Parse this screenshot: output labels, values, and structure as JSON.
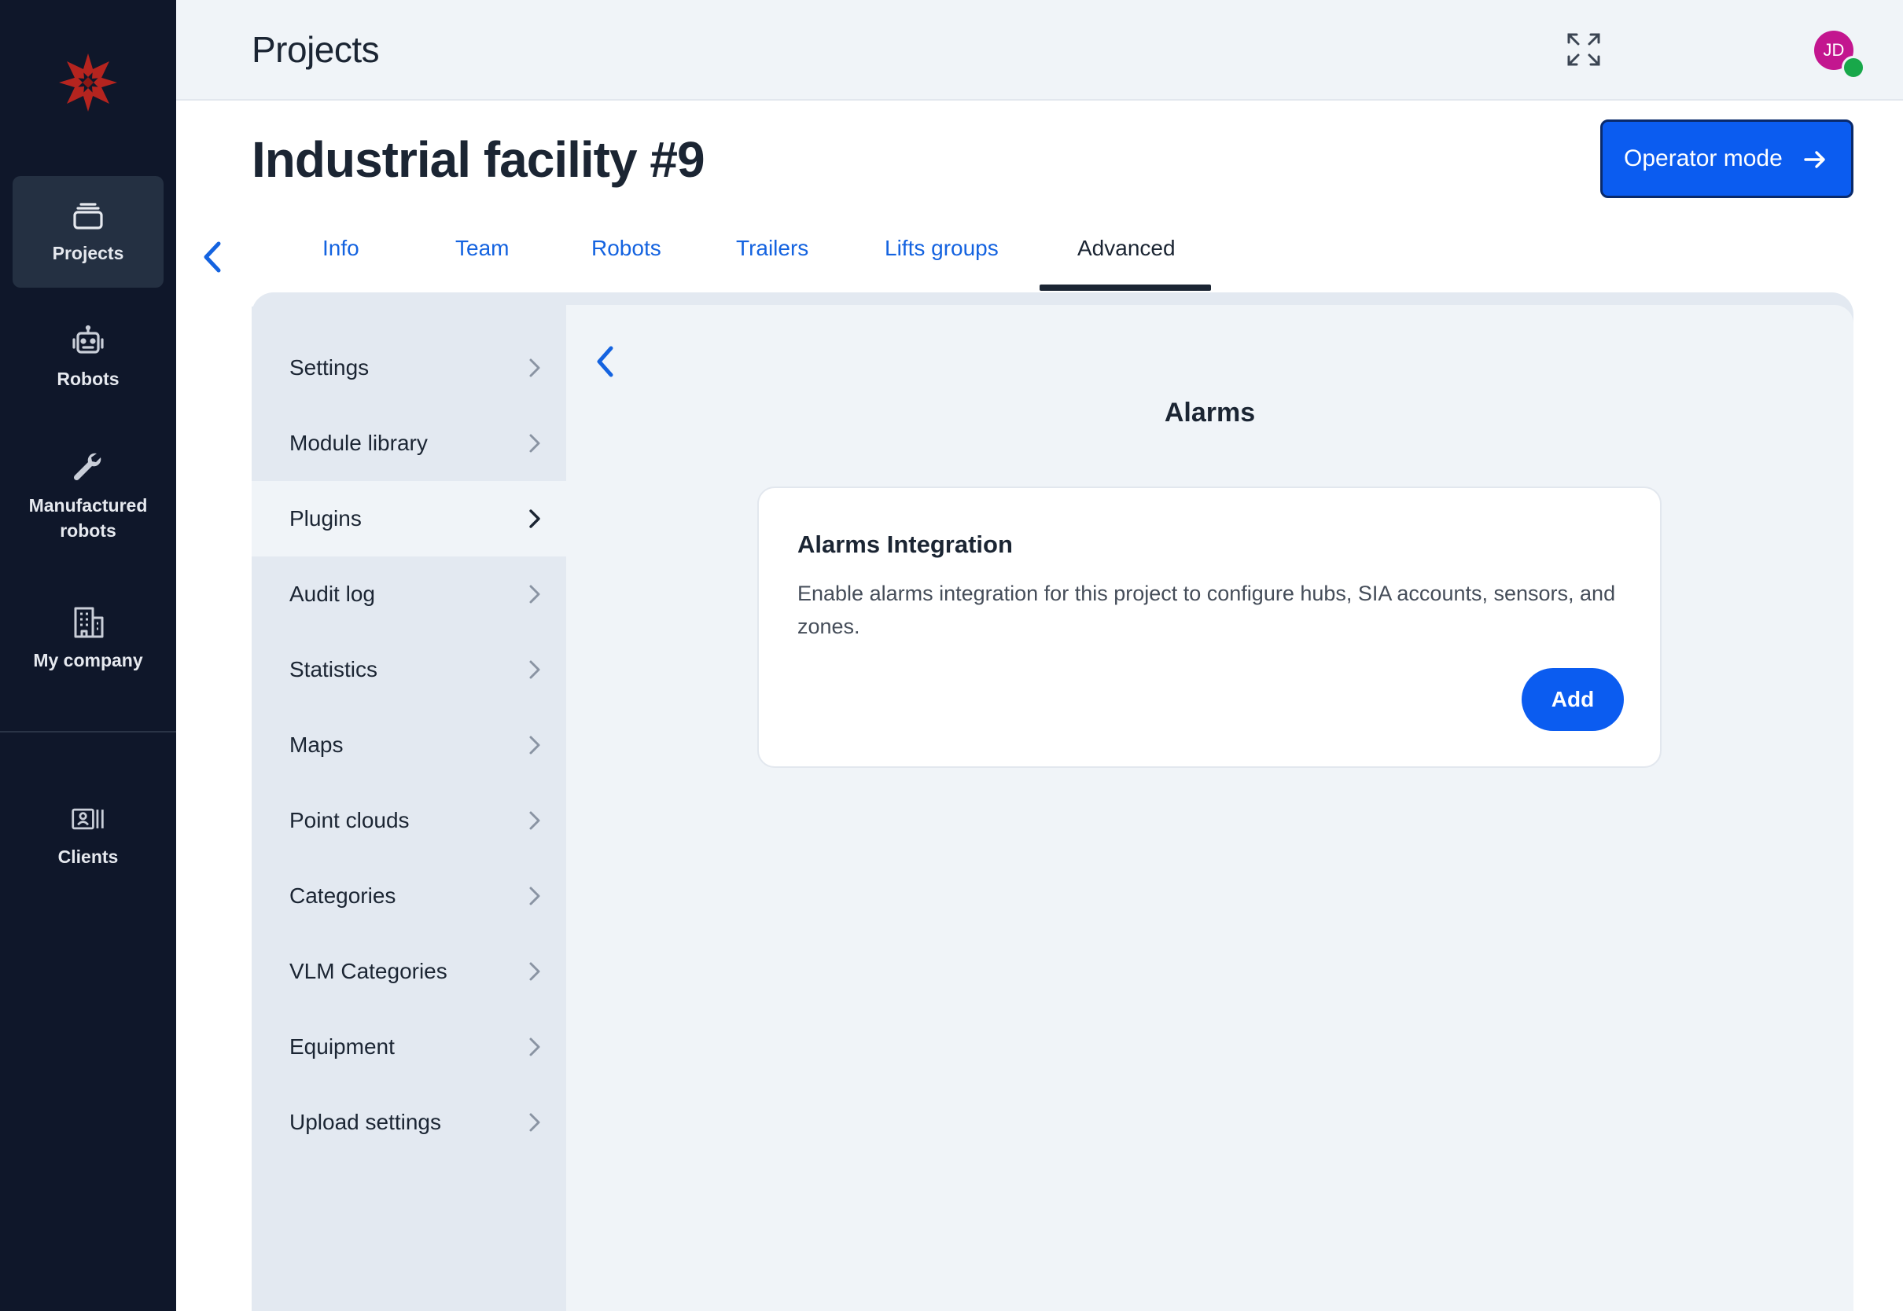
{
  "sidebar": {
    "logo_icon": "red-star-logo-icon",
    "items": [
      {
        "label": "Projects",
        "icon": "projects-stack-icon",
        "active": true
      },
      {
        "label": "Robots",
        "icon": "robot-head-icon",
        "active": false
      },
      {
        "label": "Manufactured\nrobots",
        "icon": "wrench-icon",
        "active": false
      },
      {
        "label": "My company",
        "icon": "building-icon",
        "active": false
      },
      {
        "label": "Clients",
        "icon": "contacts-card-icon",
        "active": false
      }
    ]
  },
  "topbar": {
    "title": "Projects",
    "expand_icon": "expand-icon",
    "avatar_initials": "JD",
    "status": "online"
  },
  "page": {
    "title": "Industrial facility #9",
    "operator_button": "Operator mode"
  },
  "tabs": [
    {
      "label": "Info"
    },
    {
      "label": "Team"
    },
    {
      "label": "Robots"
    },
    {
      "label": "Trailers"
    },
    {
      "label": "Lifts groups"
    },
    {
      "label": "Advanced",
      "active": true
    }
  ],
  "menu": [
    {
      "label": "Settings"
    },
    {
      "label": "Module library"
    },
    {
      "label": "Plugins",
      "active": true
    },
    {
      "label": "Audit log"
    },
    {
      "label": "Statistics"
    },
    {
      "label": "Maps"
    },
    {
      "label": "Point clouds"
    },
    {
      "label": "Categories"
    },
    {
      "label": "VLM Categories"
    },
    {
      "label": "Equipment"
    },
    {
      "label": "Upload settings"
    }
  ],
  "content": {
    "title": "Alarms",
    "card": {
      "title": "Alarms Integration",
      "description": "Enable alarms integration for this project to configure hubs, SIA accounts, sensors, and zones.",
      "add_button": "Add"
    }
  },
  "colors": {
    "sidebar_bg": "#0f172a",
    "accent": "#0b5cf0",
    "link": "#1463e0",
    "avatar": "#c3168f",
    "online": "#18a84a"
  }
}
